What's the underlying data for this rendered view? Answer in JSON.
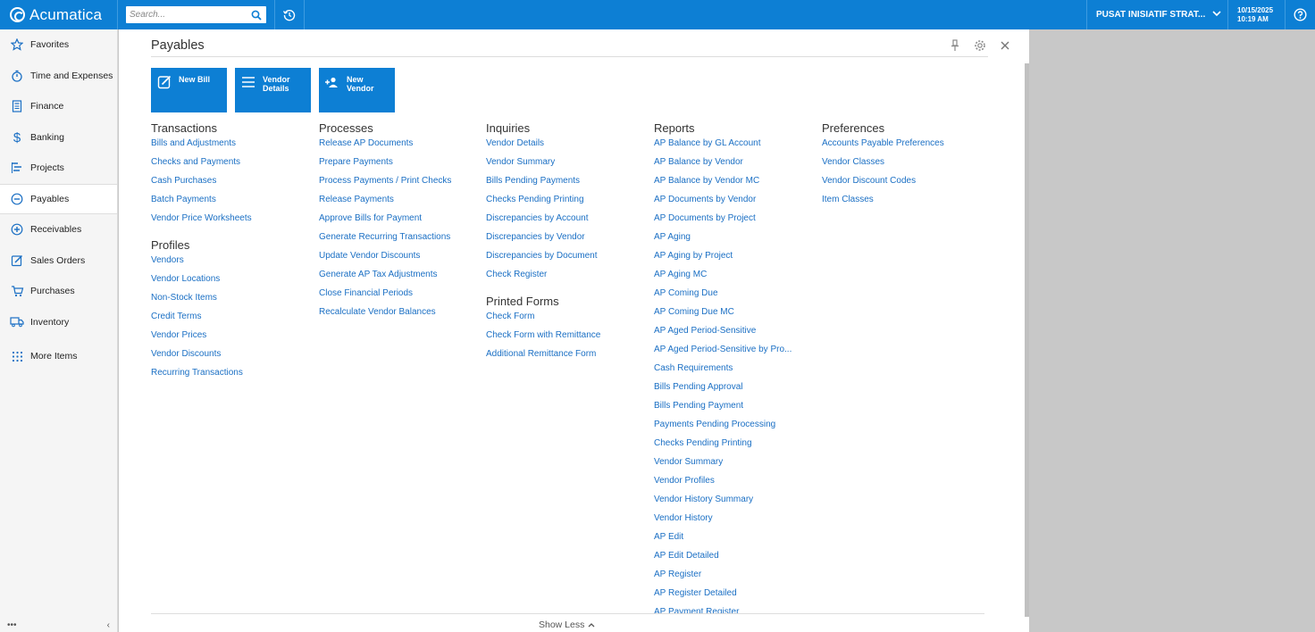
{
  "app": {
    "name": "Acumatica"
  },
  "search": {
    "placeholder": "Search..."
  },
  "header": {
    "branch": "PUSAT INISIATIF STRAT...",
    "date": "10/15/2025",
    "time": "10:19 AM"
  },
  "sidebar": {
    "items": [
      {
        "label": "Favorites",
        "icon": "star-icon"
      },
      {
        "label": "Time and Expenses",
        "icon": "stopwatch-icon"
      },
      {
        "label": "Finance",
        "icon": "calculator-icon"
      },
      {
        "label": "Banking",
        "icon": "dollar-icon"
      },
      {
        "label": "Projects",
        "icon": "projects-icon"
      },
      {
        "label": "Payables",
        "icon": "minus-circle-icon",
        "active": true
      },
      {
        "label": "Receivables",
        "icon": "plus-circle-icon"
      },
      {
        "label": "Sales Orders",
        "icon": "edit-icon"
      },
      {
        "label": "Purchases",
        "icon": "cart-icon"
      },
      {
        "label": "Inventory",
        "icon": "truck-icon"
      },
      {
        "label": "More Items",
        "icon": "grid-icon"
      }
    ],
    "bottom_left": "•••",
    "bottom_right": "‹"
  },
  "workspace": {
    "title": "Payables",
    "tiles": [
      {
        "label": "New Bill",
        "icon": "edit-icon"
      },
      {
        "label": "Vendor Details",
        "icon": "list-icon"
      },
      {
        "label": "New Vendor",
        "icon": "add-user-icon"
      }
    ],
    "columns": [
      {
        "sections": [
          {
            "title": "Transactions",
            "links": [
              "Bills and Adjustments",
              "Checks and Payments",
              "Cash Purchases",
              "Batch Payments",
              "Vendor Price Worksheets"
            ]
          },
          {
            "title": "Profiles",
            "links": [
              "Vendors",
              "Vendor Locations",
              "Non-Stock Items",
              "Credit Terms",
              "Vendor Prices",
              "Vendor Discounts",
              "Recurring Transactions"
            ]
          }
        ]
      },
      {
        "sections": [
          {
            "title": "Processes",
            "links": [
              "Release AP Documents",
              "Prepare Payments",
              "Process Payments / Print Checks",
              "Release Payments",
              "Approve Bills for Payment",
              "Generate Recurring Transactions",
              "Update Vendor Discounts",
              "Generate AP Tax Adjustments",
              "Close Financial Periods",
              "Recalculate Vendor Balances"
            ]
          }
        ]
      },
      {
        "sections": [
          {
            "title": "Inquiries",
            "links": [
              "Vendor Details",
              "Vendor Summary",
              "Bills Pending Payments",
              "Checks Pending Printing",
              "Discrepancies by Account",
              "Discrepancies by Vendor",
              "Discrepancies by Document",
              "Check Register"
            ]
          },
          {
            "title": "Printed Forms",
            "links": [
              "Check Form",
              "Check Form with Remittance",
              "Additional Remittance Form"
            ]
          }
        ]
      },
      {
        "sections": [
          {
            "title": "Reports",
            "links": [
              "AP Balance by GL Account",
              "AP Balance by Vendor",
              "AP Balance by Vendor MC",
              "AP Documents by Vendor",
              "AP Documents by Project",
              "AP Aging",
              "AP Aging by Project",
              "AP Aging MC",
              "AP Coming Due",
              "AP Coming Due MC",
              "AP Aged Period-Sensitive",
              "AP Aged Period-Sensitive by Pro...",
              "Cash Requirements",
              "Bills Pending Approval",
              "Bills Pending Payment",
              "Payments Pending Processing",
              "Checks Pending Printing",
              "Vendor Summary",
              "Vendor Profiles",
              "Vendor History Summary",
              "Vendor History",
              "AP Edit",
              "AP Edit Detailed",
              "AP Register",
              "AP Register Detailed",
              "AP Payment Register"
            ]
          }
        ]
      },
      {
        "sections": [
          {
            "title": "Preferences",
            "links": [
              "Accounts Payable Preferences",
              "Vendor Classes",
              "Vendor Discount Codes",
              "Item Classes"
            ]
          }
        ]
      }
    ],
    "show_less": "Show Less"
  }
}
